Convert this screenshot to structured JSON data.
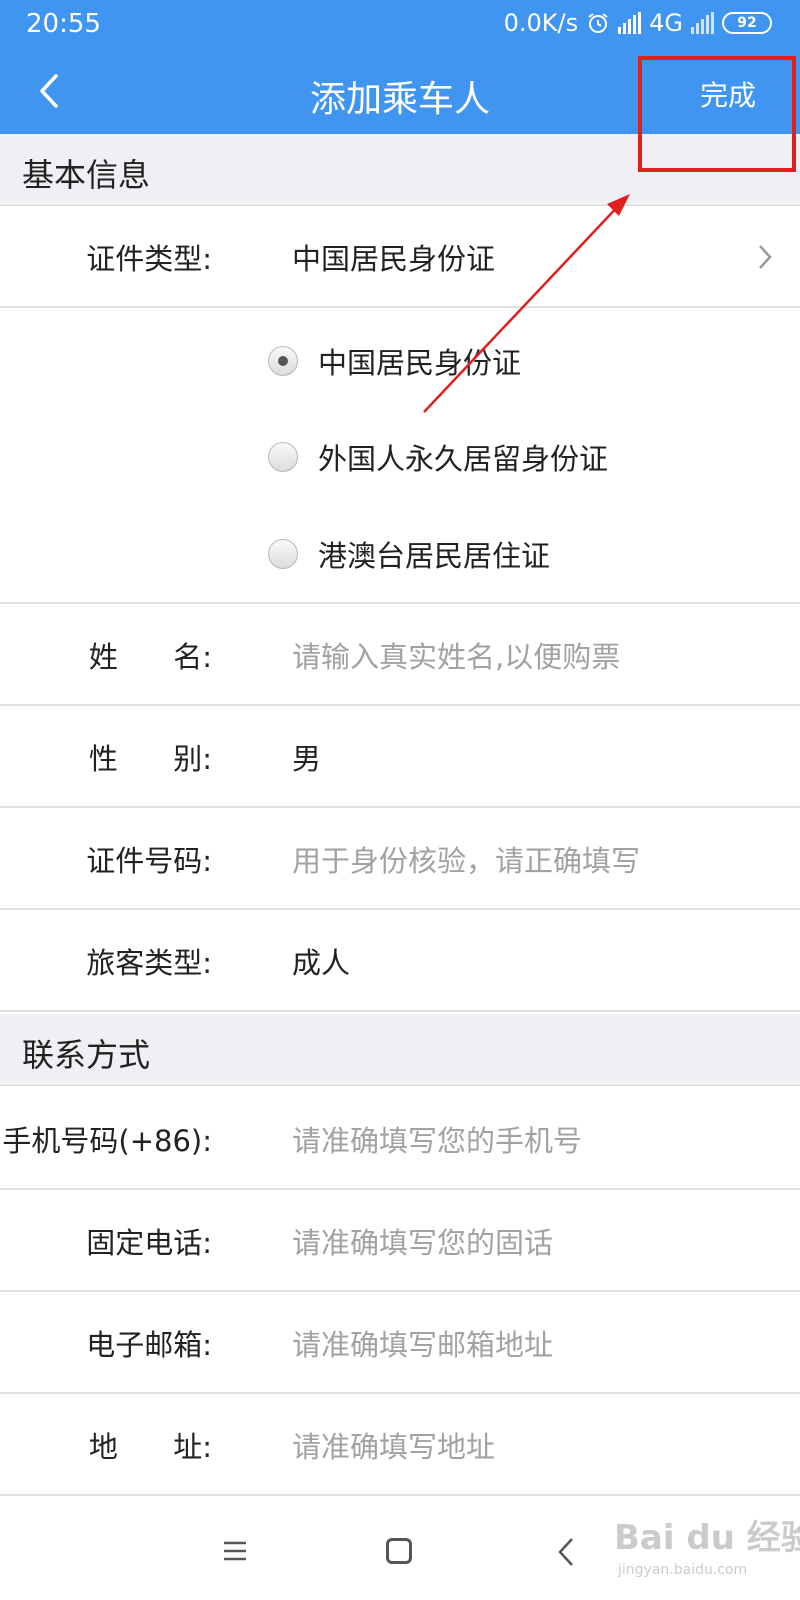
{
  "status_bar": {
    "time": "20:55",
    "net_speed": "0.0K/s",
    "network": "4G",
    "battery": "92",
    "alarm_icon": "alarm-clock-icon",
    "signal_icon": "signal-bars-icon"
  },
  "header": {
    "title": "添加乘车人",
    "back_icon": "chevron-left-icon",
    "done_label": "完成",
    "bg_color": "#3f95f0",
    "highlight_color": "#e0201e"
  },
  "basic_section": {
    "title": "基本信息",
    "id_type": {
      "label": "证件类型:",
      "value": "中国居民身份证"
    },
    "id_type_options": [
      {
        "label": "中国居民身份证",
        "selected": true
      },
      {
        "label": "外国人永久居留身份证",
        "selected": false
      },
      {
        "label": "港澳台居民居住证",
        "selected": false
      }
    ],
    "name": {
      "label": "姓      名:",
      "placeholder": "请输入真实姓名,以便购票"
    },
    "gender": {
      "label": "性      别:",
      "value": "男"
    },
    "id_number": {
      "label": "证件号码:",
      "placeholder": "用于身份核验，请正确填写"
    },
    "passenger_type": {
      "label": "旅客类型:",
      "value": "成人"
    }
  },
  "contact_section": {
    "title": "联系方式",
    "mobile": {
      "label": "手机号码(+86):",
      "placeholder": "请准确填写您的手机号"
    },
    "landline": {
      "label": "固定电话:",
      "placeholder": "请准确填写您的固话"
    },
    "email": {
      "label": "电子邮箱:",
      "placeholder": "请准确填写邮箱地址"
    },
    "address": {
      "label": "地      址:",
      "placeholder": "请准确填写地址"
    }
  },
  "watermark": {
    "text": "Bai du 经验",
    "sub": "jingyan.baidu.com"
  }
}
